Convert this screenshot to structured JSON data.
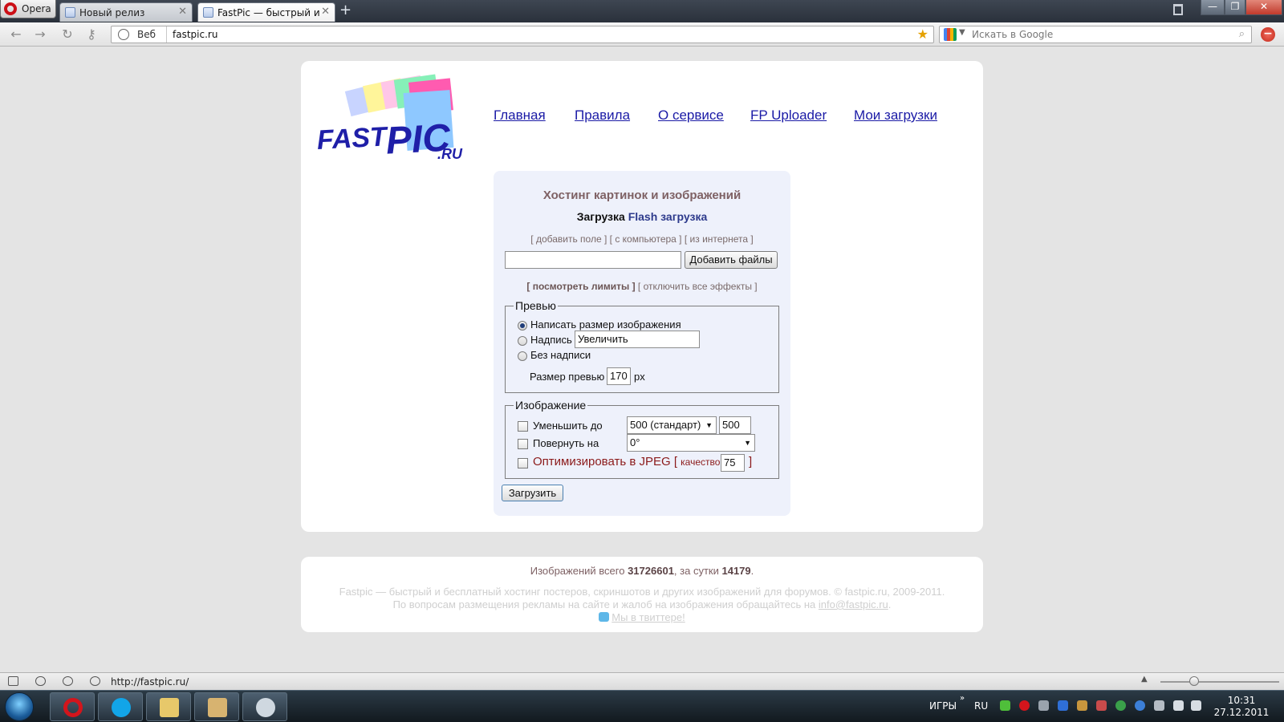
{
  "browser": {
    "opera_menu_label": "Opera",
    "tabs": [
      {
        "title": "Новый релиз",
        "active": false
      },
      {
        "title": "FastPic — быстрый и ...",
        "active": true
      }
    ],
    "new_tab_glyph": "+",
    "window_controls": {
      "minimize": "—",
      "restore": "❐",
      "close": "✕"
    },
    "address": {
      "scope_label": "Веб",
      "url": "fastpic.ru"
    },
    "search": {
      "engine_icon": "google-icon",
      "placeholder": "Искать в Google"
    }
  },
  "site": {
    "logo_text": {
      "part1": "FAST",
      "part2": "PIC",
      "tld": ".RU"
    },
    "nav": [
      "Главная",
      "Правила",
      "О сервисе",
      "FP Uploader",
      "Мои загрузки"
    ],
    "upload": {
      "title": "Хостинг картинок и изображений",
      "mode_current": "Загрузка",
      "mode_alt": "Flash загрузка",
      "source_links": {
        "add_field": "[ добавить поле ]",
        "from_computer": "[ с компьютера ]",
        "from_internet": "[ из интернета ]"
      },
      "file_value": "",
      "add_files_button": "Добавить файлы",
      "limits_link": "[ посмотреть лимиты ]",
      "effects_link": "[ отключить все эффекты ]",
      "preview": {
        "legend": "Превью",
        "options": [
          "Написать размер изображения",
          "Надпись",
          "Без надписи"
        ],
        "selected_index": 0,
        "caption_value": "Увеличить",
        "size_label": "Размер превью",
        "size_value": "170",
        "size_unit": "px"
      },
      "image": {
        "legend": "Изображение",
        "resize_label": "Уменьшить до",
        "resize_select": "500 (стандарт)",
        "resize_value": "500",
        "rotate_label": "Повернуть на",
        "rotate_select": "0°",
        "jpeg_label": "Оптимизировать в JPEG",
        "jpeg_open": "[",
        "quality_label": "качество",
        "quality_value": "75",
        "jpeg_close": "]"
      },
      "submit_button": "Загрузить"
    },
    "footer": {
      "stats_prefix": "Изображений всего",
      "stats_total": "31726601",
      "stats_mid": ", за сутки",
      "stats_day": "14179",
      "stats_end": ".",
      "copyright": "Fastpic — быстрый и бесплатный хостинг постеров, скриншотов и других изображений для форумов. © fastpic.ru, 2009-2011.",
      "ads_text": "По вопросам размещения рекламы на сайте и жалоб на изображения обращайтесь на",
      "ads_email": "info@fastpic.ru",
      "ads_end": ".",
      "twitter": "Мы в твиттере!"
    }
  },
  "statusbar": {
    "url": "http://fastpic.ru/"
  },
  "taskbar": {
    "apps": [
      "opera-icon",
      "skype-icon",
      "explorer-icon",
      "download-folder-icon",
      "paint-icon"
    ],
    "tray_games": "ИГРЫ",
    "tray_lang": "RU",
    "time": "10:31",
    "date": "27.12.2011"
  },
  "colors": {
    "nav_link": "#1a1aa6",
    "upload_panel": "#eef1fb",
    "title_text": "#7e6164",
    "jpeg_text": "#8b1a1a",
    "logo_blue": "#1f1fa8"
  }
}
